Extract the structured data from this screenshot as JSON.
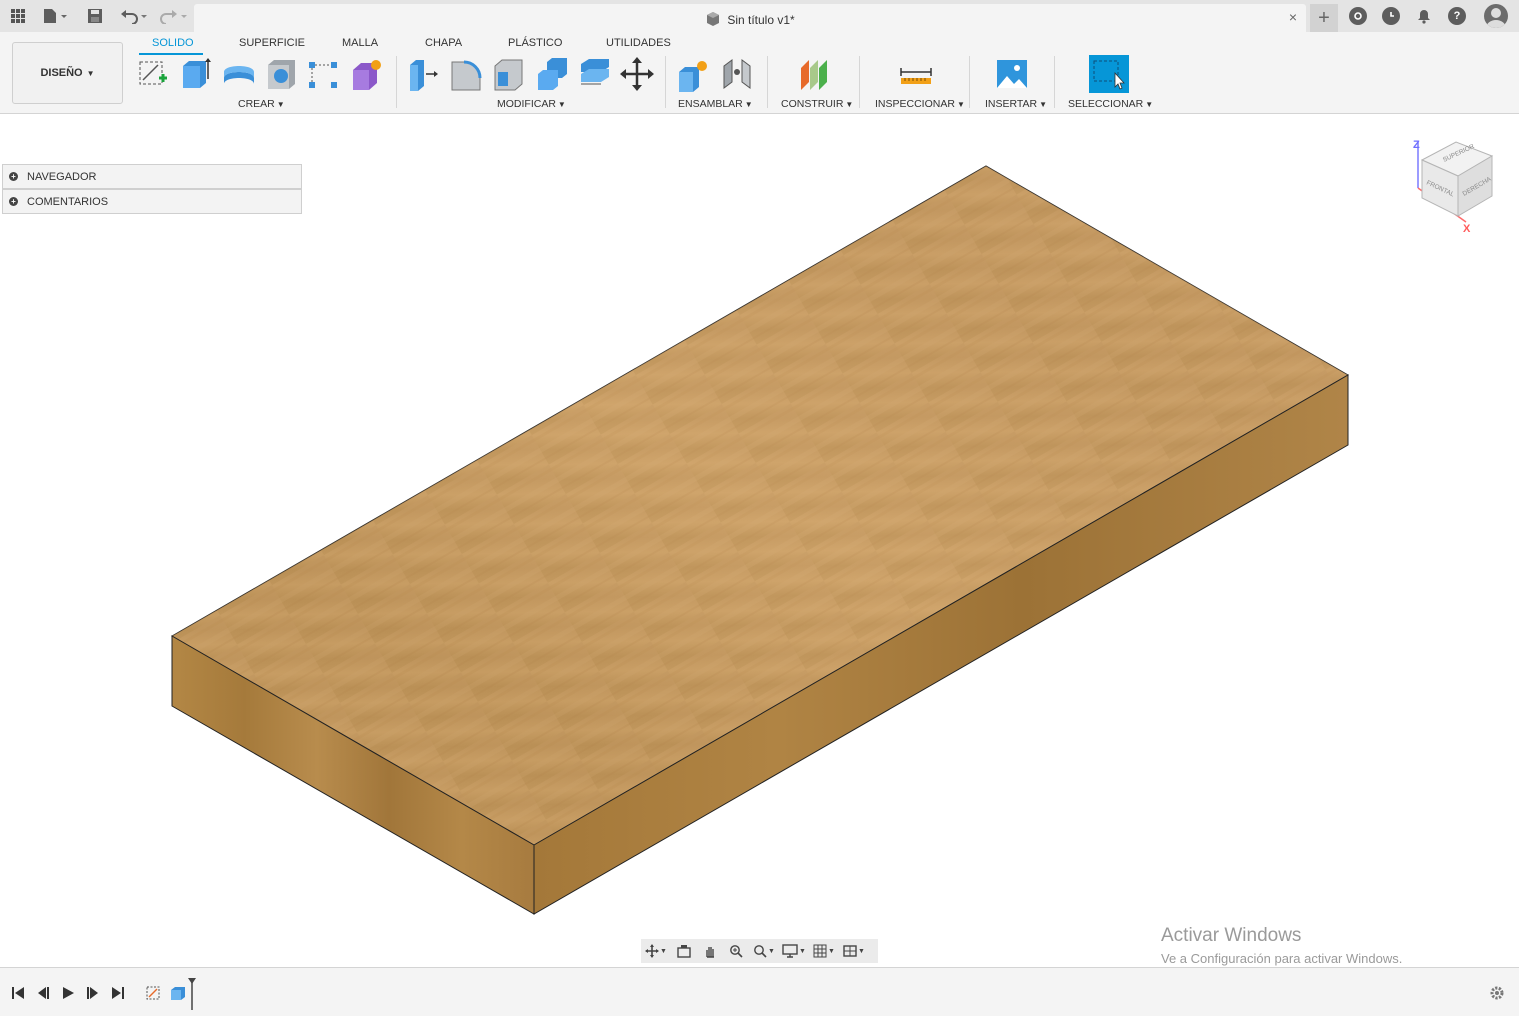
{
  "titlebar": {
    "document_title": "Sin título v1*",
    "close_glyph": "×",
    "new_tab_glyph": "+",
    "help_glyph": "?",
    "icons": [
      "apps-grid-icon",
      "file-menu-icon",
      "save-icon",
      "undo-icon",
      "redo-icon",
      "extensions-icon",
      "job-status-icon",
      "notifications-icon",
      "help-icon",
      "user-avatar-icon"
    ]
  },
  "ribbon": {
    "workspace": "DISEÑO",
    "tabs": [
      "SOLIDO",
      "SUPERFICIE",
      "MALLA",
      "CHAPA",
      "PLÁSTICO",
      "UTILIDADES"
    ],
    "active_tab": "SOLIDO",
    "groups": {
      "crear": "CREAR",
      "modificar": "MODIFICAR",
      "ensamblar": "ENSAMBLAR",
      "construir": "CONSTRUIR",
      "inspeccionar": "INSPECCIONAR",
      "insertar": "INSERTAR",
      "seleccionar": "SELECCIONAR"
    },
    "accent_color": "#0696d7"
  },
  "browser": {
    "items": [
      "NAVEGADOR",
      "COMENTARIOS"
    ]
  },
  "viewcube": {
    "faces": [
      "SUPERIOR",
      "FRONTAL",
      "DERECHA"
    ],
    "axis_z": "Z",
    "axis_x": "X"
  },
  "watermark": {
    "line1": "Activar Windows",
    "line2": "Ve a Configuración para activar Windows."
  },
  "model": {
    "material": "wood",
    "top_color": "#c99d61",
    "side_color": "#b08445"
  }
}
